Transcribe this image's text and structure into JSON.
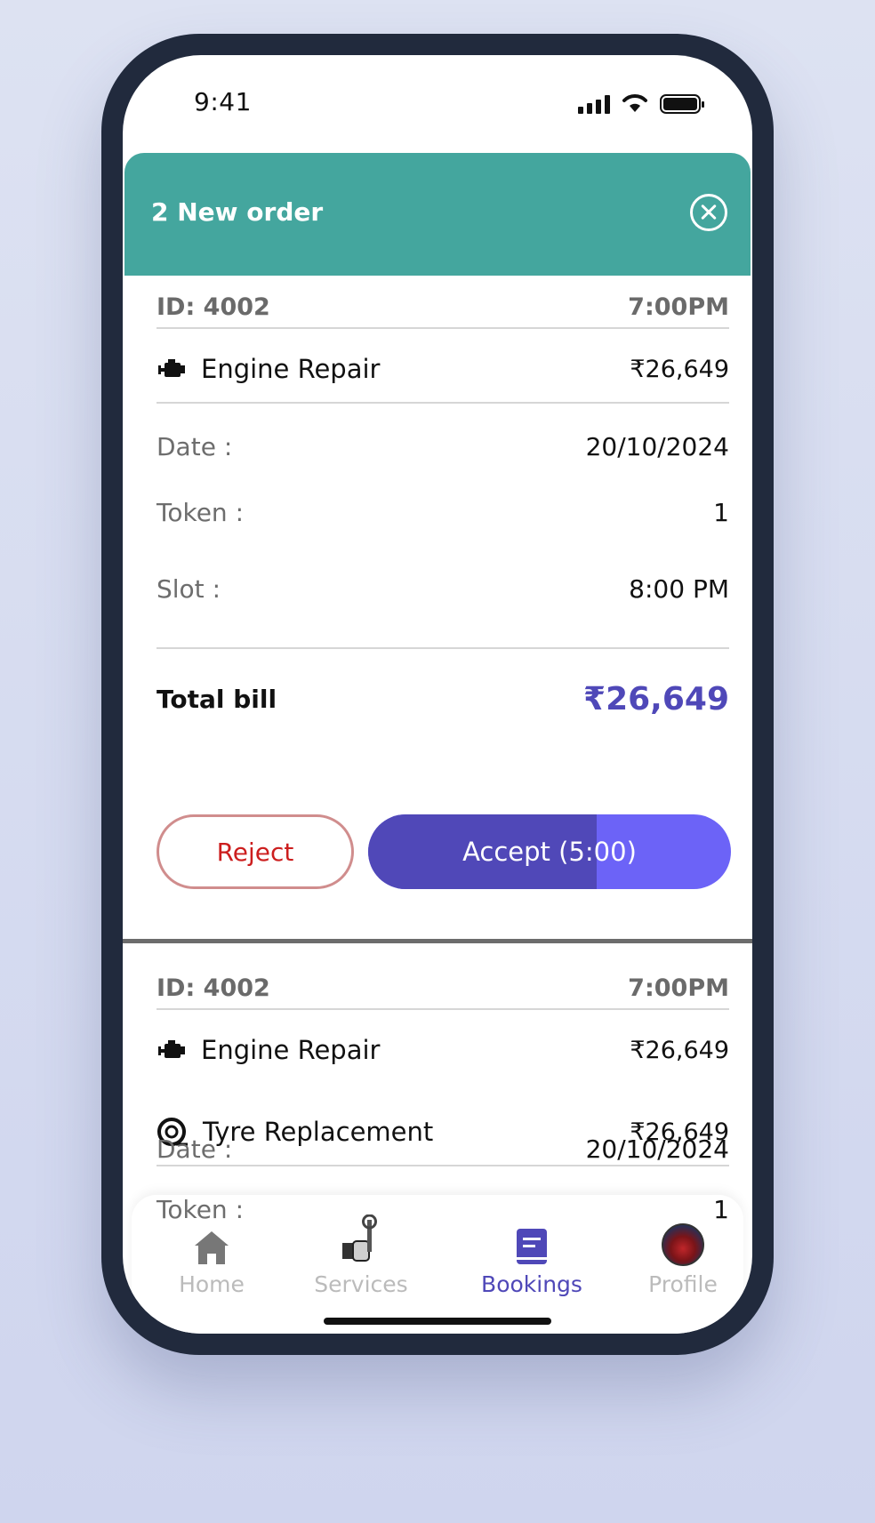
{
  "status": {
    "time": "9:41"
  },
  "header": {
    "title": "2 New order"
  },
  "order1": {
    "id": "ID: 4002",
    "time": "7:00PM",
    "service": {
      "name": "Engine Repair",
      "price": "₹26,649",
      "icon": "engine-icon"
    },
    "date_label": "Date :",
    "date": "20/10/2024",
    "token_label": "Token :",
    "token": "1",
    "slot_label": "Slot :",
    "slot": "8:00 PM",
    "total_label": "Total bill",
    "total": "₹26,649",
    "reject": "Reject",
    "accept": "Accept (5:00)",
    "accept_progress": 0.63
  },
  "order2": {
    "id": "ID: 4002",
    "time": "7:00PM",
    "services": [
      {
        "name": "Engine Repair",
        "price": "₹26,649",
        "icon": "engine-icon"
      },
      {
        "name": "Tyre Replacement",
        "price": "₹26,649",
        "icon": "tyre-icon"
      }
    ],
    "date_label": "Date :",
    "date": "20/10/2024",
    "token_label": "Token :",
    "token": "1"
  },
  "nav": {
    "items": [
      {
        "label": "Home",
        "icon": "home-icon",
        "active": false
      },
      {
        "label": "Services",
        "icon": "mechanic-icon",
        "active": false
      },
      {
        "label": "Bookings",
        "icon": "book-icon",
        "active": true
      },
      {
        "label": "Profile",
        "icon": "avatar",
        "active": false
      }
    ]
  },
  "colors": {
    "header": "#44a69e",
    "accent": "#4f48b8",
    "accept_light": "#6c63f7",
    "reject": "#cc1e1e"
  }
}
